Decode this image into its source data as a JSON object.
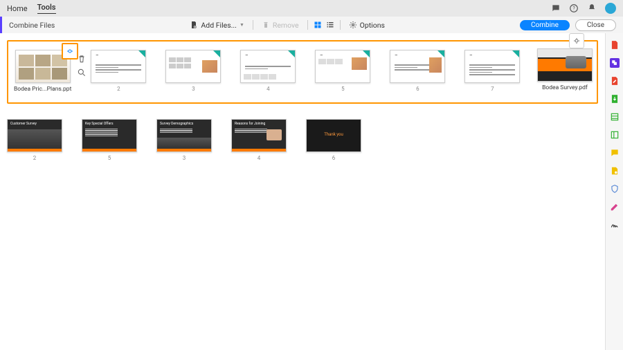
{
  "nav": {
    "home": "Home",
    "tools": "Tools"
  },
  "toolbar": {
    "title": "Combine Files",
    "add_files": "Add Files...",
    "remove": "Remove",
    "options": "Options",
    "combine": "Combine",
    "close": "Close"
  },
  "files": {
    "selected_doc": "Bodea Pric...Plans.ppt",
    "group_pages": [
      "2",
      "3",
      "4",
      "5",
      "6",
      "7"
    ],
    "last_doc": "Bodea Survey.pdf"
  },
  "row2_pages": [
    "2",
    "5",
    "3",
    "4",
    "6"
  ]
}
